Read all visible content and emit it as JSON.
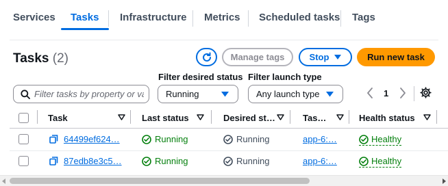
{
  "tabs": [
    {
      "label": "Services",
      "active": false
    },
    {
      "label": "Tasks",
      "active": true
    },
    {
      "label": "Infrastructure",
      "active": false
    },
    {
      "label": "Metrics",
      "active": false
    },
    {
      "label": "Scheduled tasks",
      "active": false
    },
    {
      "label": "Tags",
      "active": false
    }
  ],
  "header": {
    "title": "Tasks",
    "count": "(2)",
    "refresh_icon": "refresh-icon",
    "manage_tags_label": "Manage tags",
    "stop_label": "Stop",
    "run_new_task_label": "Run new task"
  },
  "filters": {
    "search_placeholder": "Filter tasks by property or value",
    "desired_status_label": "Filter desired status",
    "desired_status_value": "Running",
    "launch_type_label": "Filter launch type",
    "launch_type_value": "Any launch type"
  },
  "pagination": {
    "current_page": "1"
  },
  "table": {
    "columns": [
      "Task",
      "Last status",
      "Desired st…",
      "Tas…",
      "Health status"
    ],
    "rows": [
      {
        "task": "64499ef624…",
        "last_status": "Running",
        "desired_status": "Running",
        "task_definition": "app-6:…",
        "health_status": "Healthy"
      },
      {
        "task": "87edb8e3c5…",
        "last_status": "Running",
        "desired_status": "Running",
        "task_definition": "app-6:…",
        "health_status": "Healthy"
      }
    ]
  },
  "colors": {
    "accent": "#006ce0",
    "primary_button": "#ff9900",
    "success": "#037f0c",
    "text": "#0f141a"
  }
}
